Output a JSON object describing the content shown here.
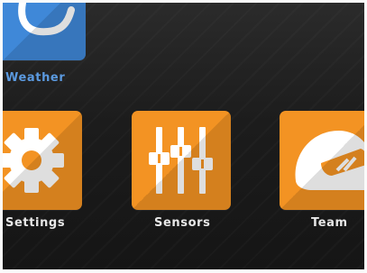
{
  "apps": [
    {
      "id": "weather",
      "label": "Weather",
      "icon": "cloud-icon",
      "color": "#3f88d8"
    },
    {
      "id": "settings",
      "label": "Settings",
      "icon": "gear-icon",
      "color": "#f39323"
    },
    {
      "id": "sensors",
      "label": "Sensors",
      "icon": "sliders-icon",
      "color": "#f39323"
    },
    {
      "id": "team",
      "label": "Team",
      "icon": "helmet-icon",
      "color": "#f39323"
    }
  ],
  "colors": {
    "background": "#1c1c1c",
    "accent_blue": "#3f88d8",
    "accent_orange": "#f39323",
    "label_text": "#e8e8e8",
    "label_blue": "#5b9ae0"
  }
}
